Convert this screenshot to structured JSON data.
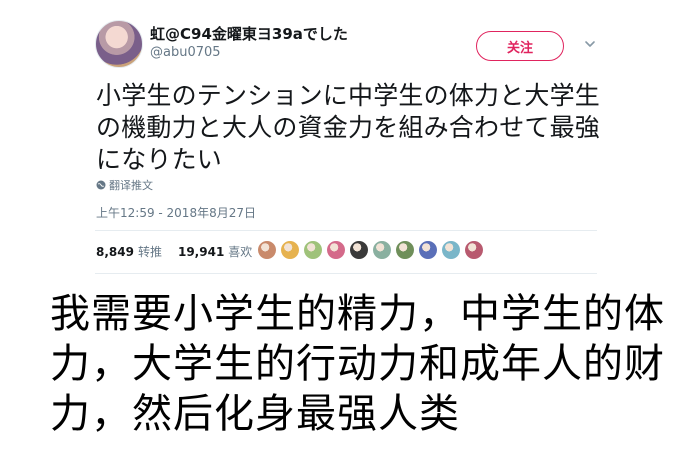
{
  "tweet": {
    "display_name": "虹@C94金曜東ヨ39aでした",
    "handle": "@abu0705",
    "follow_label": "关注",
    "text_lines": [
      "小学生のテンションに中学生の体力と大学生",
      "の機動力と大人の資金力を組み合わせて最強",
      "になりたい"
    ],
    "translate_label": "翻译推文",
    "timestamp": "上午12:59 - 2018年8月27日",
    "retweets_count": "8,849",
    "retweets_label": "转推",
    "likes_count": "19,941",
    "likes_label": "喜欢",
    "likers": [
      {
        "icon": "liker-avatar-1",
        "color": "#c98a6b"
      },
      {
        "icon": "liker-avatar-2",
        "color": "#e6b24f"
      },
      {
        "icon": "liker-avatar-3",
        "color": "#9fc27a"
      },
      {
        "icon": "liker-avatar-4",
        "color": "#d46a8a"
      },
      {
        "icon": "liker-avatar-5",
        "color": "#3a3a3a"
      },
      {
        "icon": "liker-avatar-6",
        "color": "#8ab0a0"
      },
      {
        "icon": "liker-avatar-7",
        "color": "#6f8f5a"
      },
      {
        "icon": "liker-avatar-8",
        "color": "#5a6fb8"
      },
      {
        "icon": "liker-avatar-9",
        "color": "#7ab6c9"
      },
      {
        "icon": "liker-avatar-10",
        "color": "#b85a6f"
      }
    ]
  },
  "caption": {
    "lines": [
      "我需要小学生的精力，中学生的体",
      "力，大学生的行动力和成年人的财",
      "力，然后化身最强人类"
    ]
  },
  "colors": {
    "follow_accent": "#e0245e",
    "secondary_text": "#657786",
    "divider": "#e6ecf0"
  }
}
